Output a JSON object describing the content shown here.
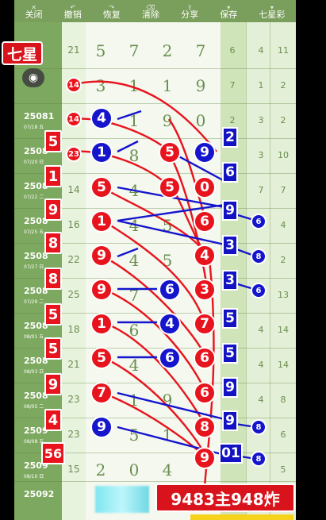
{
  "toolbar": {
    "items": [
      {
        "label": "关闭",
        "icon": "close-icon"
      },
      {
        "label": "撤销",
        "icon": "undo-icon"
      },
      {
        "label": "恢复",
        "icon": "redo-icon"
      },
      {
        "label": "清除",
        "icon": "clear-icon"
      },
      {
        "label": "分享",
        "icon": "share-icon"
      },
      {
        "label": "保存",
        "icon": "save-icon"
      },
      {
        "label": "七星彩",
        "icon": "lottery-icon"
      }
    ]
  },
  "badge": {
    "text": "七星"
  },
  "rows": [
    {
      "issue": "",
      "date": "",
      "seq": "21",
      "digits": [
        "5",
        "7",
        "2",
        "7"
      ],
      "r1": "6",
      "r2": "4",
      "r3": "11"
    },
    {
      "issue": "",
      "date": "",
      "seq": "",
      "digits": [
        "3",
        "1",
        "1",
        "9"
      ],
      "r1": "7",
      "r2": "1",
      "r3": "2"
    },
    {
      "issue": "25081",
      "date": "07/18 五",
      "seq": "",
      "digits": [
        "4",
        "1",
        "9",
        "0"
      ],
      "r1": "2",
      "r2": "3",
      "r3": "2"
    },
    {
      "issue": "2508",
      "date": "07/20 日",
      "seq": "",
      "digits": [
        "1",
        "8",
        "5",
        "9"
      ],
      "r1": "6",
      "r2": "3",
      "r3": "10"
    },
    {
      "issue": "2508",
      "date": "07/22 二",
      "seq": "14",
      "digits": [
        "5",
        "4",
        "5",
        "0"
      ],
      "r1": "7",
      "r2": "7",
      "r3": "7"
    },
    {
      "issue": "2508",
      "date": "07/25 五",
      "seq": "16",
      "digits": [
        "1",
        "4",
        "5",
        "6"
      ],
      "r1": "9",
      "r2": "6",
      "r3": "4"
    },
    {
      "issue": "2508",
      "date": "07/27 日",
      "seq": "22",
      "digits": [
        "9",
        "4",
        "5",
        "4"
      ],
      "r1": "3",
      "r2": "8",
      "r3": "2"
    },
    {
      "issue": "2508",
      "date": "07/29 二",
      "seq": "25",
      "digits": [
        "9",
        "7",
        "6",
        "3"
      ],
      "r1": "3",
      "r2": "6",
      "r3": "13"
    },
    {
      "issue": "2508",
      "date": "08/01 五",
      "seq": "18",
      "digits": [
        "1",
        "6",
        "4",
        "7"
      ],
      "r1": "5",
      "r2": "4",
      "r3": "14"
    },
    {
      "issue": "2508",
      "date": "08/03 日",
      "seq": "21",
      "digits": [
        "5",
        "4",
        "6",
        "6"
      ],
      "r1": "5",
      "r2": "4",
      "r3": "14"
    },
    {
      "issue": "2508",
      "date": "08/05 二",
      "seq": "23",
      "digits": [
        "7",
        "1",
        "9",
        "6"
      ],
      "r1": "9",
      "r2": "4",
      "r3": "8"
    },
    {
      "issue": "2509",
      "date": "08/08 五",
      "seq": "23",
      "digits": [
        "9",
        "5",
        "1",
        "8"
      ],
      "r1": "9",
      "r2": "8",
      "r3": "6"
    },
    {
      "issue": "2509",
      "date": "08/10 日",
      "seq": "15",
      "digits": [
        "2",
        "0",
        "4",
        "9"
      ],
      "r1": "01",
      "r2": "8",
      "r3": "5"
    },
    {
      "issue": "25092",
      "date": "",
      "seq": "",
      "digits": [
        "",
        "",
        "",
        ""
      ],
      "r1": "",
      "r2": "",
      "r3": ""
    }
  ],
  "left_labels": [
    "5",
    "1",
    "9",
    "8",
    "8",
    "5",
    "5",
    "9",
    "4",
    "56"
  ],
  "left_balls": [
    "14",
    "14",
    "23"
  ],
  "banner": {
    "text": "9483主948炸"
  },
  "colors": {
    "red": "#e8141d",
    "blue": "#1515cc",
    "green": "#7da85f"
  }
}
